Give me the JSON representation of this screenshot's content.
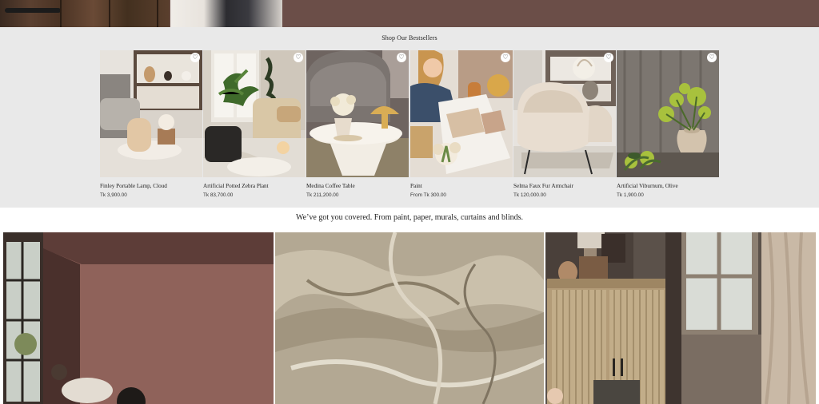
{
  "hero": {
    "image": "room-with-wooden-door"
  },
  "bestsellers": {
    "title": "Shop Our Bestsellers",
    "products": [
      {
        "name": "Finley Portable Lamp, Cloud",
        "price": "Tk 3,900.00",
        "image": "lamp-vases-shelf"
      },
      {
        "name": "Artificial Potted Zebra Plant",
        "price": "Tk 83,700.00",
        "image": "plant-living-room"
      },
      {
        "name": "Medina Coffee Table",
        "price": "Tk 211,200.00",
        "image": "coffee-table-flowers"
      },
      {
        "name": "Paint",
        "price": "From Tk 300.00",
        "image": "woman-paint-swatches"
      },
      {
        "name": "Selma Faux Fur Armchair",
        "price": "Tk 120,000.00",
        "image": "fur-armchair"
      },
      {
        "name": "Artificial Viburnum, Olive",
        "price": "Tk 1,900.00",
        "image": "green-viburnum-vase"
      }
    ],
    "wishlist_icon": "heart-icon"
  },
  "tagline": "We’ve got you covered. From paint, paper, murals, curtains and blinds.",
  "gallery": [
    {
      "image": "pink-painted-room"
    },
    {
      "image": "marble-wallpaper"
    },
    {
      "image": "cabinet-window-room"
    }
  ],
  "colors": {
    "hero_bg": "#6b4e48",
    "section_bg": "#e9e9e9",
    "text": "#222222"
  }
}
